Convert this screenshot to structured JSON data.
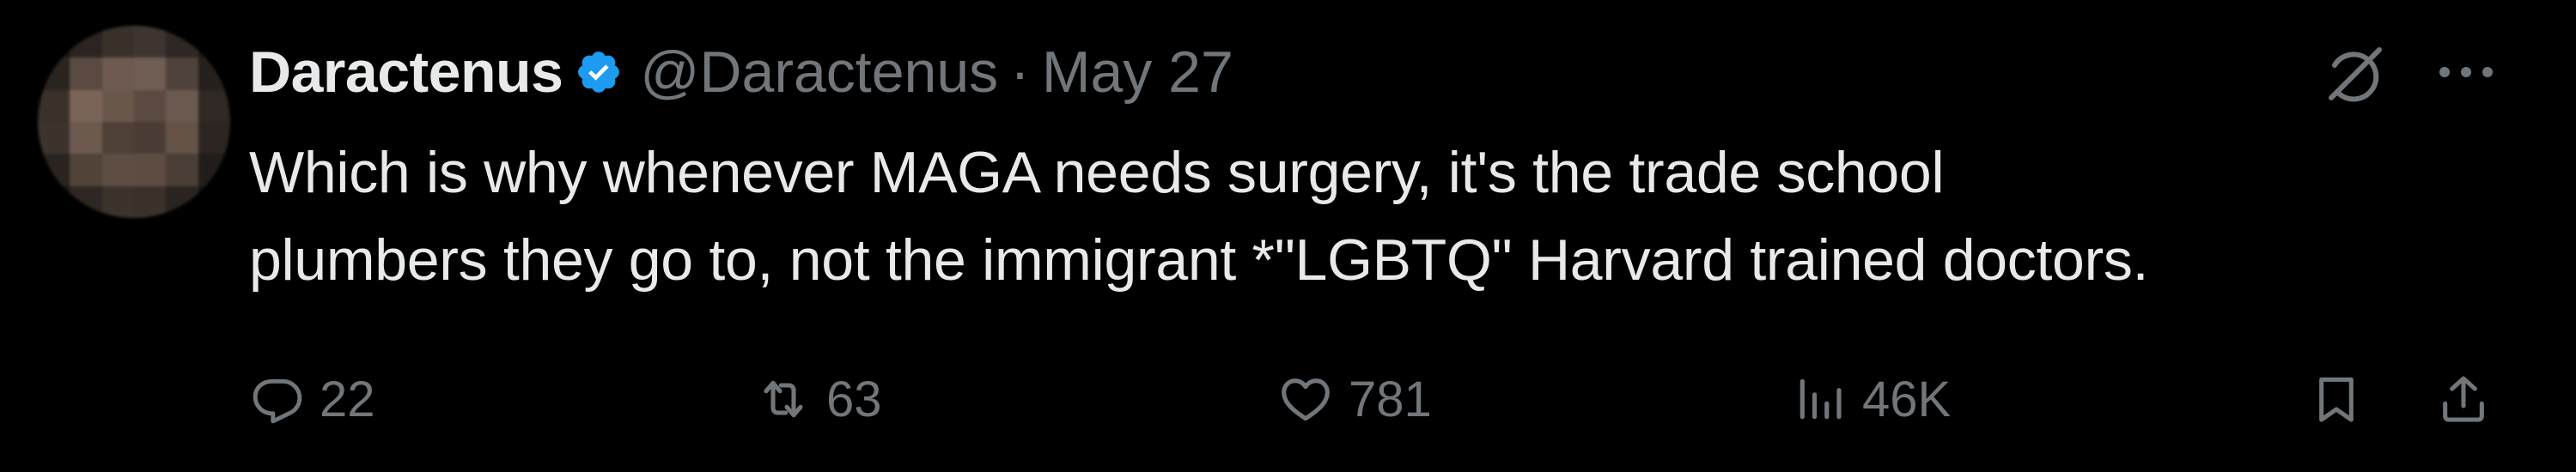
{
  "author": {
    "display_name": "Daractenus",
    "handle": "@Daractenus",
    "separator": "·",
    "date": "May 27",
    "verified": true
  },
  "tweet": {
    "lines": [
      "Which is why whenever MAGA needs surgery, it's the trade school",
      "plumbers they go to, not the immigrant *\"LGBTQ\" Harvard trained doctors."
    ]
  },
  "actions": {
    "replies": "22",
    "retweets": "63",
    "likes": "781",
    "views": "46K"
  },
  "icons": {
    "verified": "verified-badge-icon",
    "grok": "grok-icon",
    "more": "more-icon",
    "reply": "reply-icon",
    "retweet": "retweet-icon",
    "like": "heart-icon",
    "views": "views-icon",
    "bookmark": "bookmark-icon",
    "share": "share-icon"
  },
  "colors": {
    "background": "#000000",
    "primary_text": "#e7e9ea",
    "secondary_text": "#71767b",
    "verified_blue": "#1d9bf0"
  }
}
